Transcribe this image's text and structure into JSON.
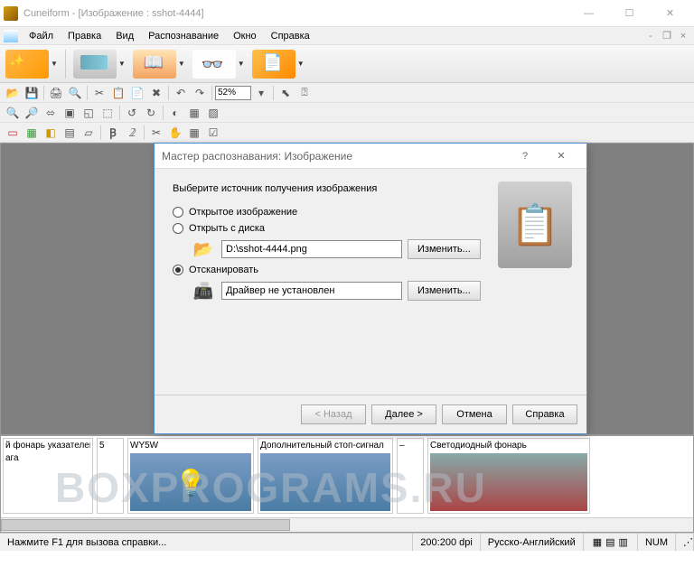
{
  "window": {
    "title": "Cuneiform - [Изображение : sshot-4444]"
  },
  "menu": {
    "file": "Файл",
    "edit": "Правка",
    "view": "Вид",
    "recognize": "Распознавание",
    "window_": "Окно",
    "help": "Справка"
  },
  "toolbar": {
    "zoom_value": "52%"
  },
  "dialog": {
    "title": "Мастер распознавания: Изображение",
    "instruction": "Выберите источник получения изображения",
    "opt_opened": "Открытое изображение",
    "opt_disk": "Открыть с диска",
    "disk_path": "D:\\sshot-4444.png",
    "change_btn": "Изменить...",
    "opt_scan": "Отсканировать",
    "scan_status": "Драйвер не установлен",
    "btn_back": "< Назад",
    "btn_next": "Далее >",
    "btn_cancel": "Отмена",
    "btn_help": "Справка"
  },
  "thumbs": {
    "t1a": "й фонарь указателей",
    "t1b": "ага",
    "t2": "5",
    "t3": "WY5W",
    "t4": "Дополнительный стоп-сигнал",
    "t5": "–",
    "t6": "Светодиодный фонарь"
  },
  "status": {
    "hint": "Нажмите F1 для вызова справки...",
    "dpi": "200:200 dpi",
    "lang": "Русско-Английский",
    "num": "NUM"
  },
  "watermark": "BOXPROGRAMS.RU"
}
